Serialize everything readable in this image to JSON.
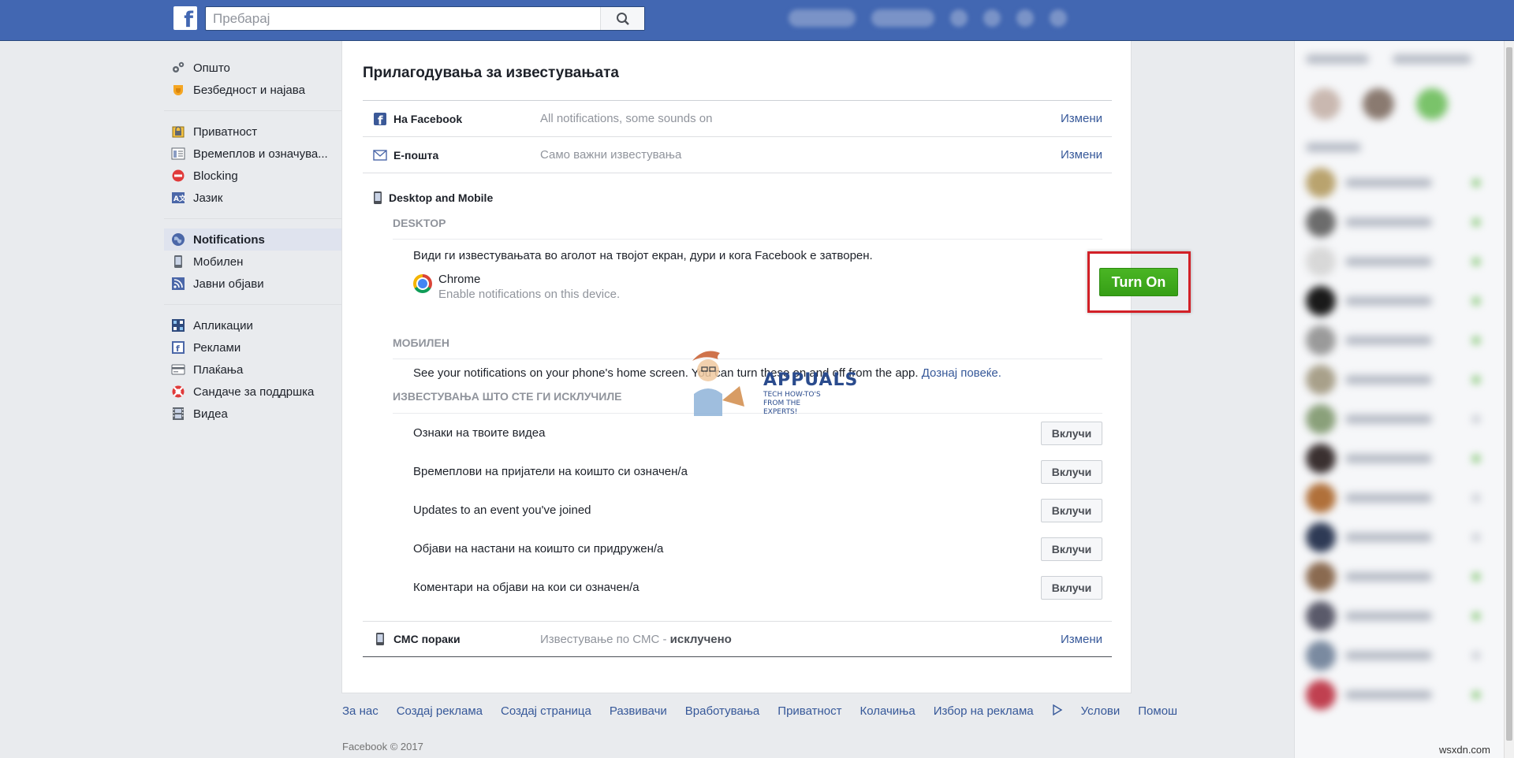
{
  "topbar": {
    "logo_letter": "f",
    "search_placeholder": "Пребарај"
  },
  "leftnav": {
    "groups": [
      [
        {
          "label": "Општо",
          "icon": "gears-icon"
        },
        {
          "label": "Безбедност и најава",
          "icon": "shield-badge-icon"
        }
      ],
      [
        {
          "label": "Приватност",
          "icon": "lock-icon"
        },
        {
          "label": "Времеплов и означува...",
          "icon": "timeline-icon"
        },
        {
          "label": "Blocking",
          "icon": "block-icon"
        },
        {
          "label": "Јазик",
          "icon": "language-icon"
        }
      ],
      [
        {
          "label": "Notifications",
          "icon": "globe-icon",
          "active": true
        },
        {
          "label": "Мобилен",
          "icon": "mobile-icon"
        },
        {
          "label": "Јавни објави",
          "icon": "rss-icon"
        }
      ],
      [
        {
          "label": "Апликации",
          "icon": "apps-icon"
        },
        {
          "label": "Реклами",
          "icon": "ads-icon"
        },
        {
          "label": "Плаќања",
          "icon": "card-icon"
        },
        {
          "label": "Сандаче за поддршка",
          "icon": "lifebuoy-icon"
        },
        {
          "label": "Видеа",
          "icon": "film-icon"
        }
      ]
    ]
  },
  "main": {
    "title": "Прилагодувања за известувањата",
    "rows": {
      "facebook": {
        "label": "На Facebook",
        "value": "All notifications, some sounds on",
        "edit": "Измени"
      },
      "email": {
        "label": "Е-пошта",
        "value": "Само важни известувања",
        "edit": "Измени"
      }
    },
    "desktop_mobile": {
      "heading": "Desktop and Mobile",
      "desktop_head": "DESKTOP",
      "desktop_desc": "Види ги известувањата во аголот на твојот екран, дури и кога Facebook е затворен.",
      "chrome_name": "Chrome",
      "chrome_sub": "Enable notifications on this device.",
      "turn_on": "Turn On",
      "mobile_head": "МОБИЛЕН",
      "mobile_desc": "See your notifications on your phone's home screen. You can turn these on and off from the app.",
      "learn_more": "Дознај повеќе.",
      "off_head": "ИЗВЕСТУВАЊА ШТО СТЕ ГИ ИСКЛУЧИЛЕ",
      "off_items": [
        {
          "label": "Ознаки на твоите видеа",
          "button": "Вклучи"
        },
        {
          "label": "Времеплови на пријатели на коишто си означен/а",
          "button": "Вклучи"
        },
        {
          "label": "Updates to an event you've joined",
          "button": "Вклучи"
        },
        {
          "label": "Објави на настани на коишто си придружен/а",
          "button": "Вклучи"
        },
        {
          "label": "Коментари на објави на кои си означен/а",
          "button": "Вклучи"
        }
      ]
    },
    "sms": {
      "label": "СМС пораки",
      "value_prefix": "Известување по СМС - ",
      "value_bold": "исклучено",
      "edit": "Измени"
    }
  },
  "footer": {
    "links": [
      "За нас",
      "Создај реклама",
      "Создај страница",
      "Развивачи",
      "Вработувања",
      "Приватност",
      "Колачиња",
      "Избор на реклама",
      "Услови",
      "Помош"
    ],
    "copyright": "Facebook © 2017"
  },
  "watermark": {
    "brand": "APPUALS",
    "tagline": "TECH HOW-TO'S FROM THE EXPERTS!",
    "site": "wsxdn.com"
  },
  "colors": {
    "brand_blue": "#4267b2",
    "link": "#365899",
    "turn_on_green": "#42b72a",
    "highlight_red": "#d22027"
  }
}
